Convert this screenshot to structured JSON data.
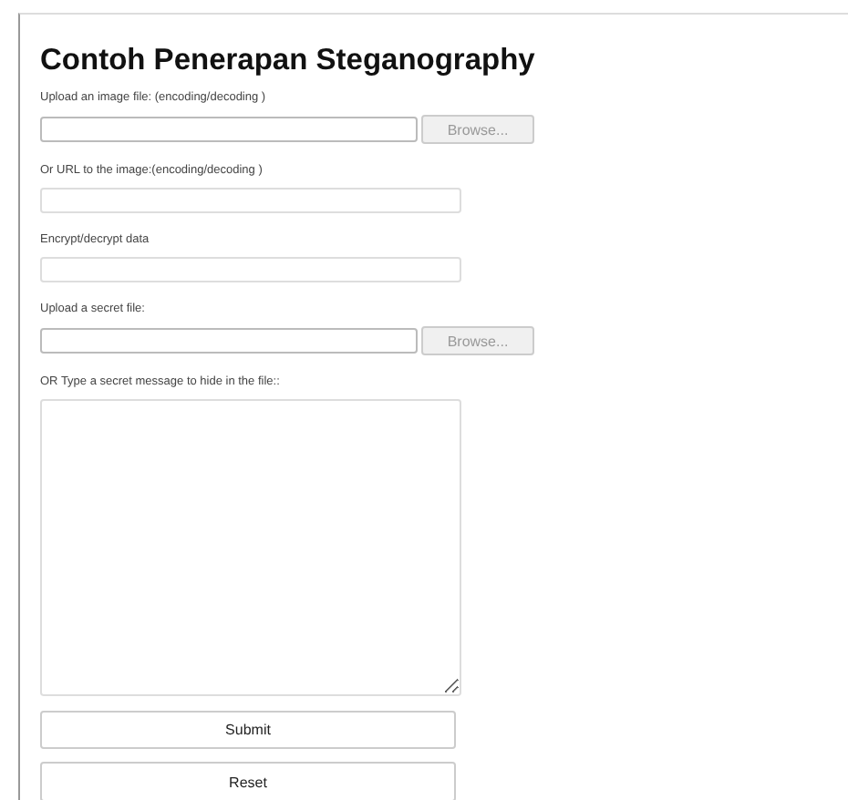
{
  "title": "Contoh Penerapan Steganography",
  "fields": [
    {
      "kind": "file",
      "label": "Upload an image file: (encoding/decoding )",
      "button": "Browse..."
    },
    {
      "kind": "text",
      "label": "Or URL to the image:(encoding/decoding )"
    },
    {
      "kind": "text",
      "label": "Encrypt/decrypt data"
    },
    {
      "kind": "file",
      "label": "Upload a secret file:",
      "button": "Browse..."
    },
    {
      "kind": "textarea",
      "label": "OR Type a secret message to hide in the file::"
    }
  ],
  "buttons": [
    "Submit",
    "Reset"
  ]
}
